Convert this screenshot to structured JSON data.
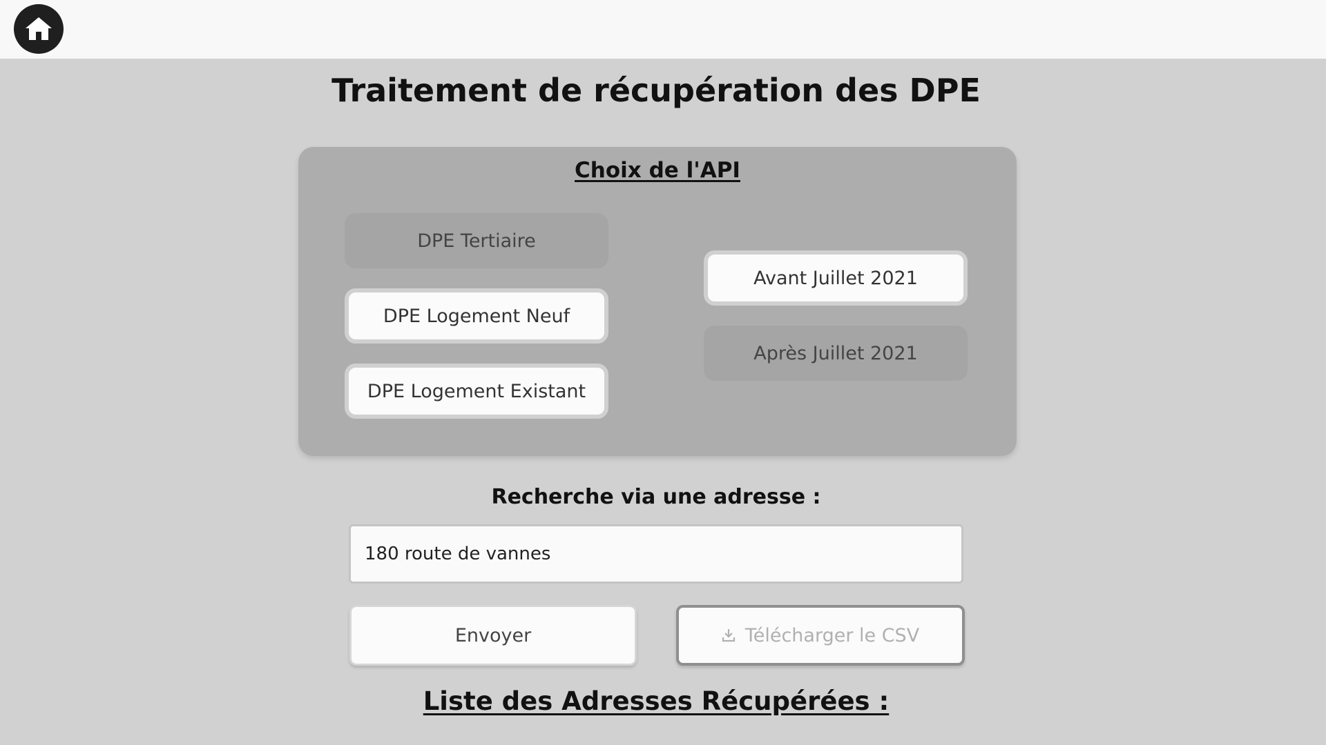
{
  "header": {
    "home_icon": "home-icon"
  },
  "page": {
    "title": "Traitement de récupération des DPE"
  },
  "api_panel": {
    "title": "Choix de l'API",
    "types": [
      {
        "label": "DPE Tertiaire",
        "selected": false
      },
      {
        "label": "DPE Logement Neuf",
        "selected": true
      },
      {
        "label": "DPE Logement Existant",
        "selected": true
      }
    ],
    "periods": [
      {
        "label": "Avant Juillet 2021",
        "selected": true
      },
      {
        "label": "Après Juillet 2021",
        "selected": false
      }
    ]
  },
  "search": {
    "label": "Recherche via une adresse :",
    "value": "180 route de vannes"
  },
  "actions": {
    "send_label": "Envoyer",
    "csv_label": "Télécharger le CSV",
    "csv_icon": "download-icon",
    "csv_disabled": true
  },
  "results": {
    "title": "Liste des Adresses Récupérées :"
  },
  "colors": {
    "background": "#d1d1d1",
    "topbar": "#f8f8f8",
    "panel": "#adadad",
    "option_off": "#a5a5a5",
    "option_on": "#fbfbfb"
  }
}
